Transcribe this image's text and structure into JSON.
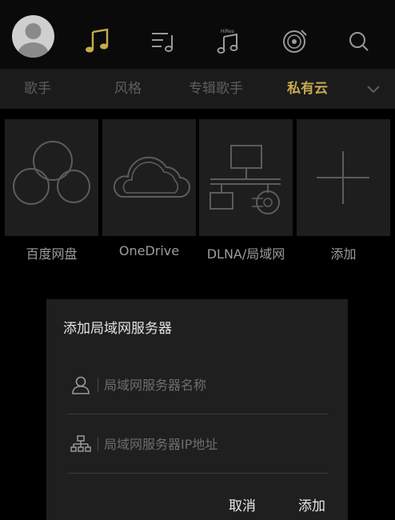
{
  "header": {
    "icons": [
      "user-avatar",
      "music-note-icon",
      "playlist-icon",
      "hires-music-icon",
      "vinyl-disc-icon",
      "search-icon"
    ],
    "accent_color": "#c9a94f"
  },
  "tabs": [
    {
      "label": "歌手",
      "active": false
    },
    {
      "label": "风格",
      "active": false
    },
    {
      "label": "专辑歌手",
      "active": false
    },
    {
      "label": "私有云",
      "active": true
    }
  ],
  "sources": [
    {
      "label": "百度网盘",
      "icon": "baidu-cloud-icon"
    },
    {
      "label": "OneDrive",
      "icon": "onedrive-cloud-icon"
    },
    {
      "label": "DLNA/局域网",
      "icon": "network-icon"
    },
    {
      "label": "添加",
      "icon": "plus-icon"
    }
  ],
  "dialog": {
    "title": "添加局域网服务器",
    "name_field": {
      "placeholder": "局域网服务器名称",
      "value": ""
    },
    "ip_field": {
      "placeholder": "局域网服务器IP地址",
      "value": ""
    },
    "cancel_label": "取消",
    "add_label": "添加"
  }
}
